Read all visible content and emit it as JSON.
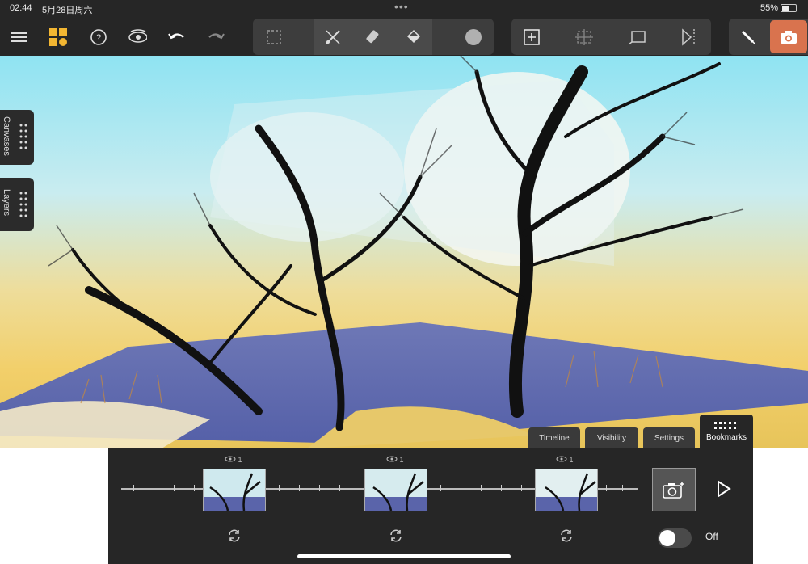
{
  "status": {
    "time": "02:44",
    "date": "5月28日周六",
    "battery": "55%"
  },
  "toolbar": {
    "icons": [
      "menu-icon",
      "gallery-icon",
      "help-icon",
      "view-icon",
      "undo-icon",
      "redo-icon",
      "selection-icon",
      "brush-icon",
      "eraser-icon",
      "fill-icon",
      "color-swatch",
      "add-layer-icon",
      "transform-icon",
      "shape-icon",
      "flip-icon",
      "pen-icon",
      "camera-icon"
    ],
    "accent": "#d9734e",
    "brush_color": "#b0b0b0"
  },
  "side_tabs": {
    "canvases": "Canvases",
    "layers": "Layers"
  },
  "panel": {
    "tabs": [
      "Timeline",
      "Visibility",
      "Settings",
      "Bookmarks"
    ],
    "selected_tab": "Bookmarks",
    "bookmarks": [
      {
        "visibility_count": "1"
      },
      {
        "visibility_count": "1"
      },
      {
        "visibility_count": "1"
      }
    ],
    "toggle_label": "Off"
  }
}
